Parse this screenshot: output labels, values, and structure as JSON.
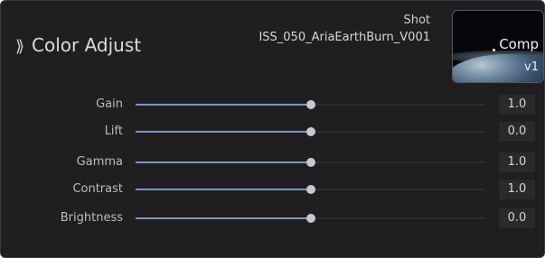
{
  "header": {
    "chevron": "⟫",
    "title": "Color Adjust",
    "shot_label": "Shot",
    "shot_name": "ISS_050_AriaEarthBurn_V001"
  },
  "thumbnail": {
    "comp_label": "Comp",
    "version_label": "v1"
  },
  "controls": [
    {
      "label": "Gain",
      "value": "1.0",
      "level": 0.5
    },
    {
      "label": "Lift",
      "value": "0.0",
      "level": 0.5
    },
    {
      "label": "Gamma",
      "value": "1.0",
      "level": 0.5
    },
    {
      "label": "Contrast",
      "value": "1.0",
      "level": 0.5
    },
    {
      "label": "Brightness",
      "value": "0.0",
      "level": 0.5
    }
  ],
  "colors": {
    "panel_bg": "#1f1f21",
    "slider_fill": "#7d95c2",
    "knob": "#c9c9c9"
  }
}
